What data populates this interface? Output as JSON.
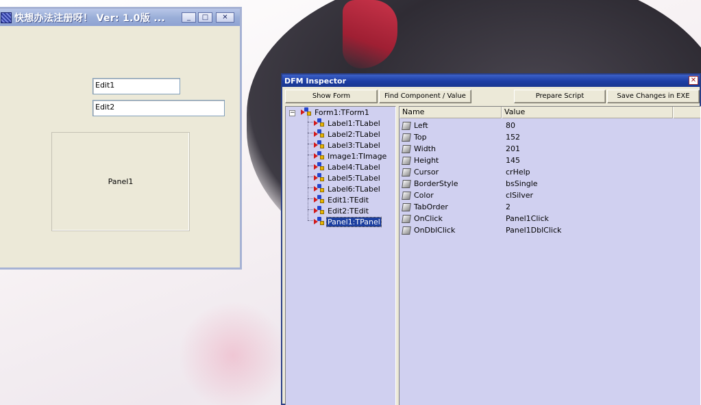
{
  "form_window": {
    "title": "快想办法注册呀！  Ver: 1.0版 ...",
    "controls": {
      "minimize": "_",
      "maximize": "□",
      "close": "✕"
    },
    "edit1": "Edit1",
    "edit2": "Edit2",
    "panel1": "Panel1"
  },
  "dfm_inspector": {
    "title": "DFM Inspector",
    "close_glyph": "✕",
    "toolbar": {
      "show_form": "Show Form",
      "find": "Find Component / Value",
      "prepare": "Prepare Script",
      "save": "Save Changes in EXE"
    },
    "tree": {
      "expander": "−",
      "root": "Form1:TForm1",
      "children": [
        "Label1:TLabel",
        "Label2:TLabel",
        "Label3:TLabel",
        "Image1:TImage",
        "Label4:TLabel",
        "Label5:TLabel",
        "Label6:TLabel",
        "Edit1:TEdit",
        "Edit2:TEdit",
        "Panel1:TPanel"
      ],
      "selected": "Panel1:TPanel"
    },
    "grid": {
      "headers": [
        "Name",
        "Value"
      ],
      "rows": [
        {
          "name": "Left",
          "value": "80"
        },
        {
          "name": "Top",
          "value": "152"
        },
        {
          "name": "Width",
          "value": "201"
        },
        {
          "name": "Height",
          "value": "145"
        },
        {
          "name": "Cursor",
          "value": "crHelp"
        },
        {
          "name": "BorderStyle",
          "value": "bsSingle"
        },
        {
          "name": "Color",
          "value": "clSilver"
        },
        {
          "name": "TabOrder",
          "value": "2"
        },
        {
          "name": "OnClick",
          "value": "Panel1Click"
        },
        {
          "name": "OnDblClick",
          "value": "Panel1DblClick"
        }
      ]
    }
  }
}
